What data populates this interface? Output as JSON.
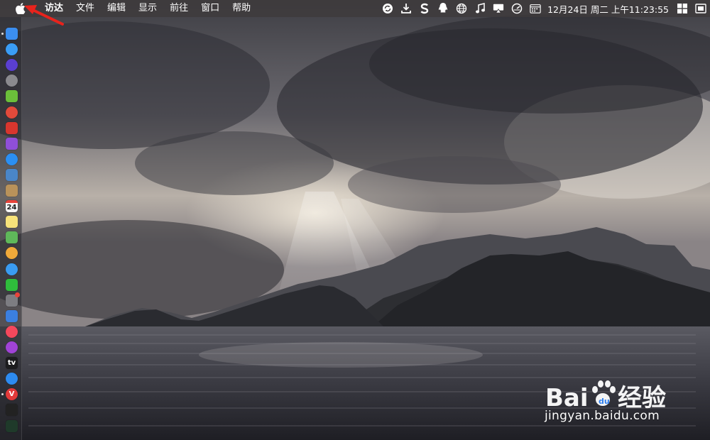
{
  "menubar": {
    "apple_icon": "apple-logo-icon",
    "items": [
      "访达",
      "文件",
      "编辑",
      "显示",
      "前往",
      "窗口",
      "帮助"
    ],
    "status_icons": [
      "sync-icon",
      "download-icon",
      "s-app-icon",
      "qq-icon",
      "globe-icon",
      "music-note-icon",
      "airplay-icon",
      "gauge-icon",
      "calendar-icon"
    ],
    "clock": "12月24日 周二 上午11:23:55",
    "trailing_icons": [
      "microsoft-icon",
      "display-toggle-icon"
    ]
  },
  "dock": {
    "items": [
      {
        "name": "finder",
        "label": "",
        "color": "#3b8ef0",
        "running": true
      },
      {
        "name": "app-store-blue",
        "label": "",
        "color": "#3a9df5",
        "running": false
      },
      {
        "name": "siri",
        "label": "",
        "color": "#5a3fd1",
        "running": false
      },
      {
        "name": "launchpad",
        "label": "",
        "color": "#8a8a8e",
        "running": false
      },
      {
        "name": "android",
        "label": "",
        "color": "#6bbf3a",
        "running": false
      },
      {
        "name": "chrome",
        "label": "",
        "color": "#e24a3b",
        "running": false
      },
      {
        "name": "dictionary-red",
        "label": "",
        "color": "#d7362e",
        "running": false
      },
      {
        "name": "purple-app",
        "label": "",
        "color": "#8f4fd8",
        "running": false
      },
      {
        "name": "safari",
        "label": "",
        "color": "#2b8ff2",
        "running": false
      },
      {
        "name": "preview",
        "label": "",
        "color": "#4a86c8",
        "running": false
      },
      {
        "name": "notebook",
        "label": "",
        "color": "#b9925a",
        "running": false
      },
      {
        "name": "calendar",
        "label": "24",
        "color": "#f4f4f4",
        "running": false
      },
      {
        "name": "notes",
        "label": "",
        "color": "#f7e27a",
        "running": false
      },
      {
        "name": "maps",
        "label": "",
        "color": "#5fb85a",
        "running": false
      },
      {
        "name": "photos",
        "label": "",
        "color": "#f0a93a",
        "running": false
      },
      {
        "name": "messages",
        "label": "",
        "color": "#3a9cf2",
        "running": false
      },
      {
        "name": "wechat",
        "label": "",
        "color": "#2fbd3c",
        "running": false
      },
      {
        "name": "system-preferences",
        "label": "",
        "color": "#7d7d82",
        "running": false,
        "badge": true
      },
      {
        "name": "keynote",
        "label": "",
        "color": "#3b7fe0",
        "running": false
      },
      {
        "name": "music",
        "label": "",
        "color": "#f5485c",
        "running": false
      },
      {
        "name": "podcasts",
        "label": "",
        "color": "#a043d6",
        "running": false
      },
      {
        "name": "apple-tv",
        "label": "tv",
        "color": "#1c1c1e",
        "running": false
      },
      {
        "name": "app-store",
        "label": "",
        "color": "#2d8bf0",
        "running": false
      },
      {
        "name": "vivaldi",
        "label": "V",
        "color": "#e23a3a",
        "running": true
      },
      {
        "name": "terminal",
        "label": "",
        "color": "#222222",
        "running": false
      },
      {
        "name": "activity-monitor",
        "label": "",
        "color": "#1f3a2a",
        "running": false
      }
    ]
  },
  "annotation": {
    "arrow_color": "#e8231c"
  },
  "watermark": {
    "logo_text": "Bai",
    "logo_suffix": "经验",
    "url": "jingyan.baidu.com"
  }
}
